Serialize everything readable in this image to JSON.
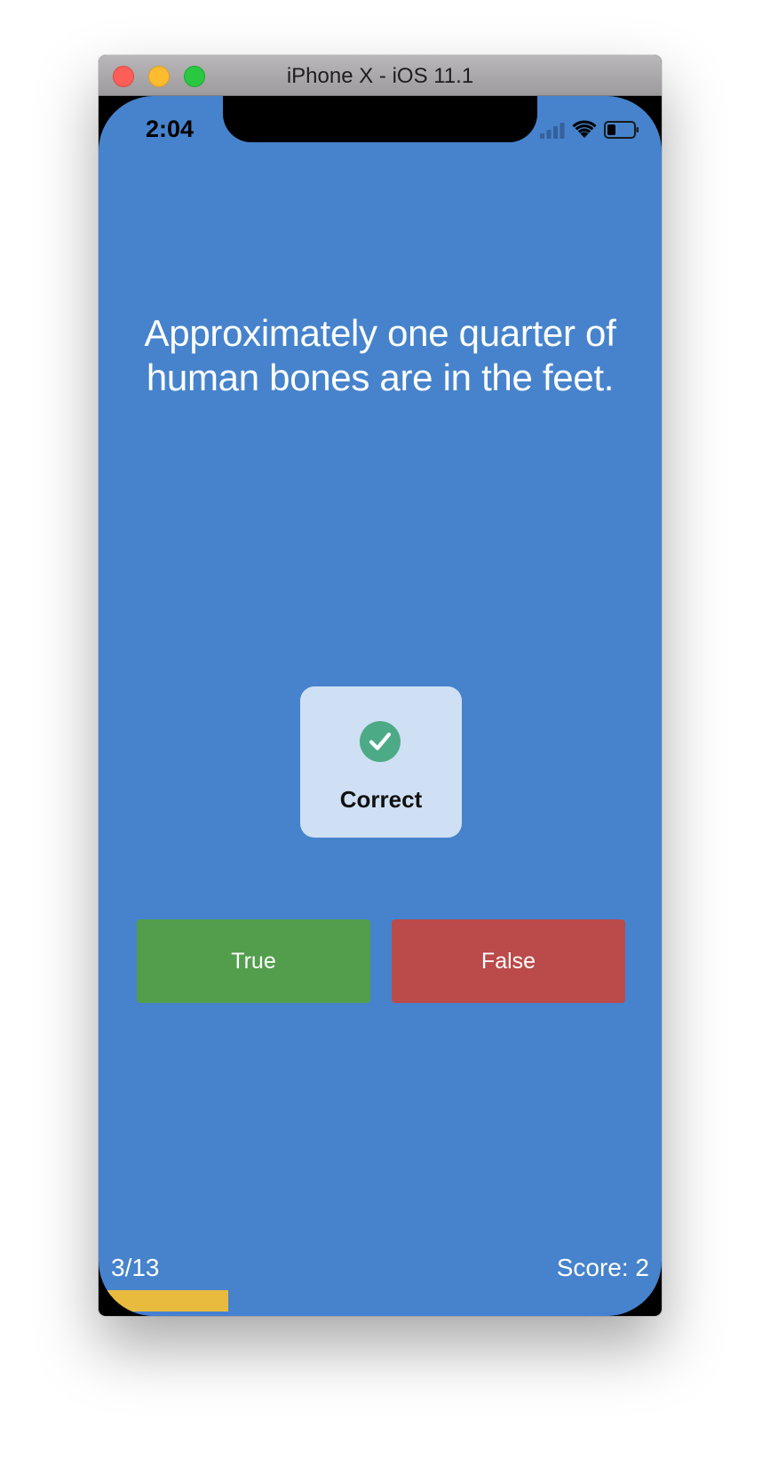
{
  "window": {
    "title": "iPhone X - iOS 11.1"
  },
  "status_bar": {
    "time": "2:04",
    "icons": [
      "signal-icon",
      "wifi-icon",
      "battery-icon"
    ]
  },
  "quiz": {
    "question": "Approximately one quarter of human bones are in the feet.",
    "feedback": {
      "label": "Correct",
      "icon": "check-circle-icon"
    },
    "true_label": "True",
    "false_label": "False",
    "progress_text": "3/13",
    "score_text": "Score: 2",
    "progress_fraction": 0.2308
  },
  "colors": {
    "background": "#4683cc",
    "true_button": "#529e4d",
    "false_button": "#bb4a4a",
    "feedback_card": "#cfe0f4",
    "check_circle": "#4daa86",
    "progress_fill": "#e8bb3f"
  }
}
